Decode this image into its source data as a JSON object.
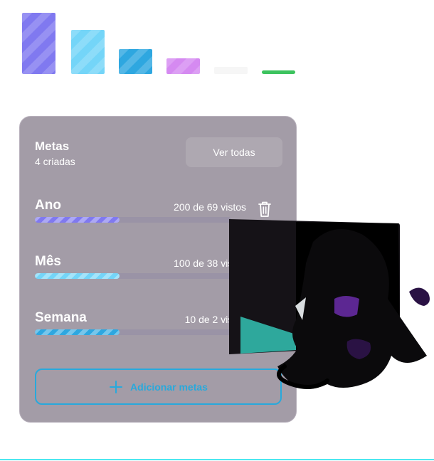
{
  "swatches": [
    {
      "color": "#8079f0",
      "striped": true
    },
    {
      "color": "#74d5f8",
      "striped": true
    },
    {
      "color": "#2ea7e0",
      "striped": true
    },
    {
      "color": "#d58af1",
      "striped": true
    },
    {
      "color": "#f6f6f6",
      "striped": false
    },
    {
      "color": "#3cc35e",
      "striped": false
    }
  ],
  "card": {
    "title": "Metas",
    "subtitle": "4 criadas",
    "see_all_label": "Ver todas",
    "add_label": "Adicionar metas"
  },
  "goals": [
    {
      "name": "Ano",
      "count": "200 de 69 vistos",
      "progress": 0.43,
      "color": "#8079f0",
      "icon": "trash-icon"
    },
    {
      "name": "Mês",
      "count": "100 de 38 vistos",
      "progress": 0.43,
      "color": "#74d5f8",
      "icon": "trash-icon"
    },
    {
      "name": "Semana",
      "count": "10 de 2 vistos",
      "progress": 0.43,
      "color": "#2ea7e0",
      "icon": "trash-icon"
    }
  ],
  "colors": {
    "card_bg": "#a39ca7",
    "accent": "#28a9dc",
    "bottom_line": "#4de8f0"
  }
}
